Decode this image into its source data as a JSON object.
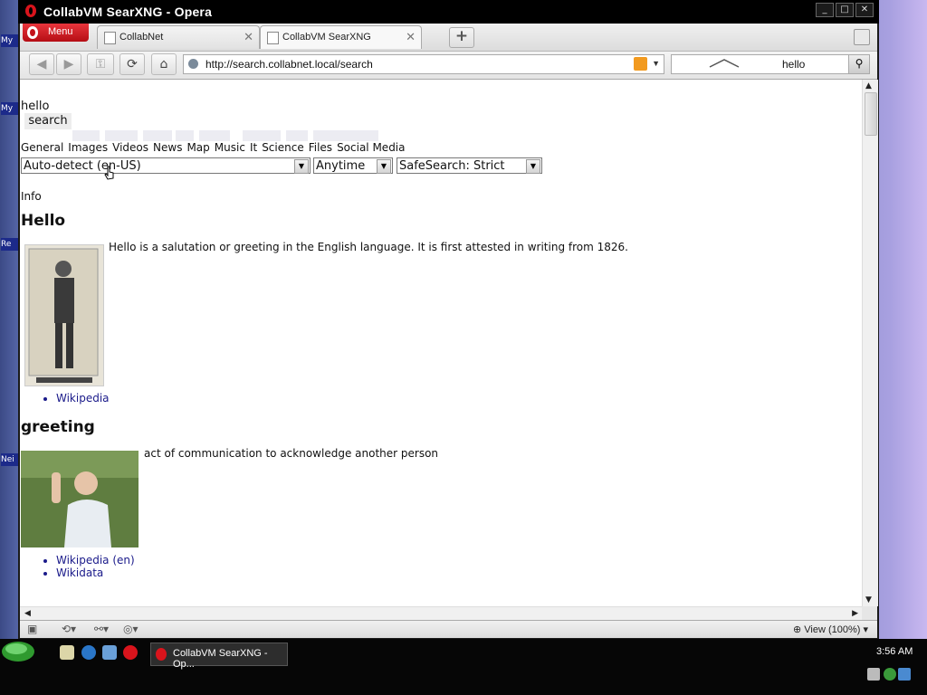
{
  "window": {
    "title": "CollabVM SearXNG - Opera",
    "menu_label": "Menu",
    "tabs": [
      {
        "label": "CollabNet",
        "active": false
      },
      {
        "label": "CollabVM SearXNG",
        "active": true
      }
    ],
    "new_tab_label": "+"
  },
  "addressbar": {
    "url": "http://search.collabnet.local/search",
    "search_value": "hello"
  },
  "page": {
    "query": "hello",
    "search_button": "search",
    "categories": [
      "General",
      "Images",
      "Videos",
      "News",
      "Map",
      "Music",
      "It",
      "Science",
      "Files",
      "Social Media"
    ],
    "language_select": "Auto-detect (en-US)",
    "time_select": "Anytime",
    "safesearch_select": "SafeSearch: Strict",
    "info_label": "Info",
    "results": [
      {
        "title": "Hello",
        "text": "Hello is a salutation or greeting in the English language. It is first attested in writing from 1826.",
        "links": [
          "Wikipedia"
        ]
      },
      {
        "title": "greeting",
        "text": "act of communication to acknowledge another person",
        "links": [
          "Wikipedia (en)",
          "Wikidata"
        ]
      }
    ]
  },
  "statusbar": {
    "zoom_label": "View (100%)"
  },
  "taskbar": {
    "task_label": "CollabVM SearXNG - Op...",
    "clock": "3:56 AM"
  },
  "desktop": {
    "icon_labels": [
      "My",
      "My",
      "Re",
      "Nei"
    ]
  },
  "colors": {
    "link": "#1a1a8a",
    "opera_red": "#d9141c"
  }
}
